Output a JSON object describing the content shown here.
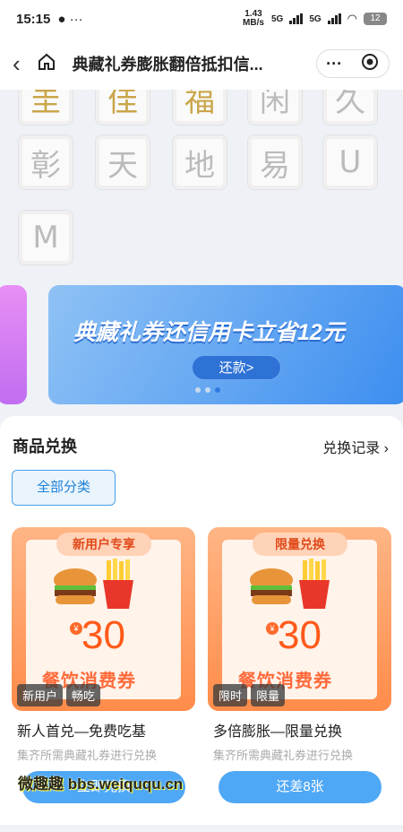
{
  "status_bar": {
    "time": "15:15",
    "speed": "1.43 MB/s",
    "net1": "5G",
    "net2": "5G",
    "battery": "12"
  },
  "nav": {
    "title": "典藏礼券膨胀翻倍抵扣信..."
  },
  "cards": [
    {
      "char": "圭",
      "style": "gold"
    },
    {
      "char": "佳",
      "style": "gold"
    },
    {
      "char": "福",
      "style": "gold"
    },
    {
      "char": "闲",
      "style": "silver"
    },
    {
      "char": "久",
      "style": "silver"
    },
    {
      "char": "彰",
      "style": "silver"
    },
    {
      "char": "天",
      "style": "silver"
    },
    {
      "char": "地",
      "style": "silver"
    },
    {
      "char": "易",
      "style": "silver"
    },
    {
      "char": "U",
      "style": "silver"
    },
    {
      "char": "M",
      "style": "silver"
    }
  ],
  "banner": {
    "headline": "典藏礼券还信用卡立省12元",
    "button": "还款>"
  },
  "section": {
    "title": "商品兑换",
    "record_link": "兑换记录 ›",
    "filter": "全部分类"
  },
  "products": [
    {
      "ribbon": "新用户专享",
      "amount": "30",
      "yen": "¥",
      "coupon_title": "餐饮消费券",
      "tags": [
        "新用户",
        "畅吃"
      ],
      "name": "新人首兑—免费吃基",
      "desc": "集齐所需典藏礼券进行兑换",
      "button": "立即兑换"
    },
    {
      "ribbon": "限量兑换",
      "amount": "30",
      "yen": "¥",
      "coupon_title": "餐饮消费券",
      "tags": [
        "限时",
        "限量"
      ],
      "name": "多倍膨胀—限量兑换",
      "desc": "集齐所需典藏礼券进行兑换",
      "button": "还差8张"
    }
  ],
  "watermark": "微趣趣 bbs.weiququ.cn"
}
